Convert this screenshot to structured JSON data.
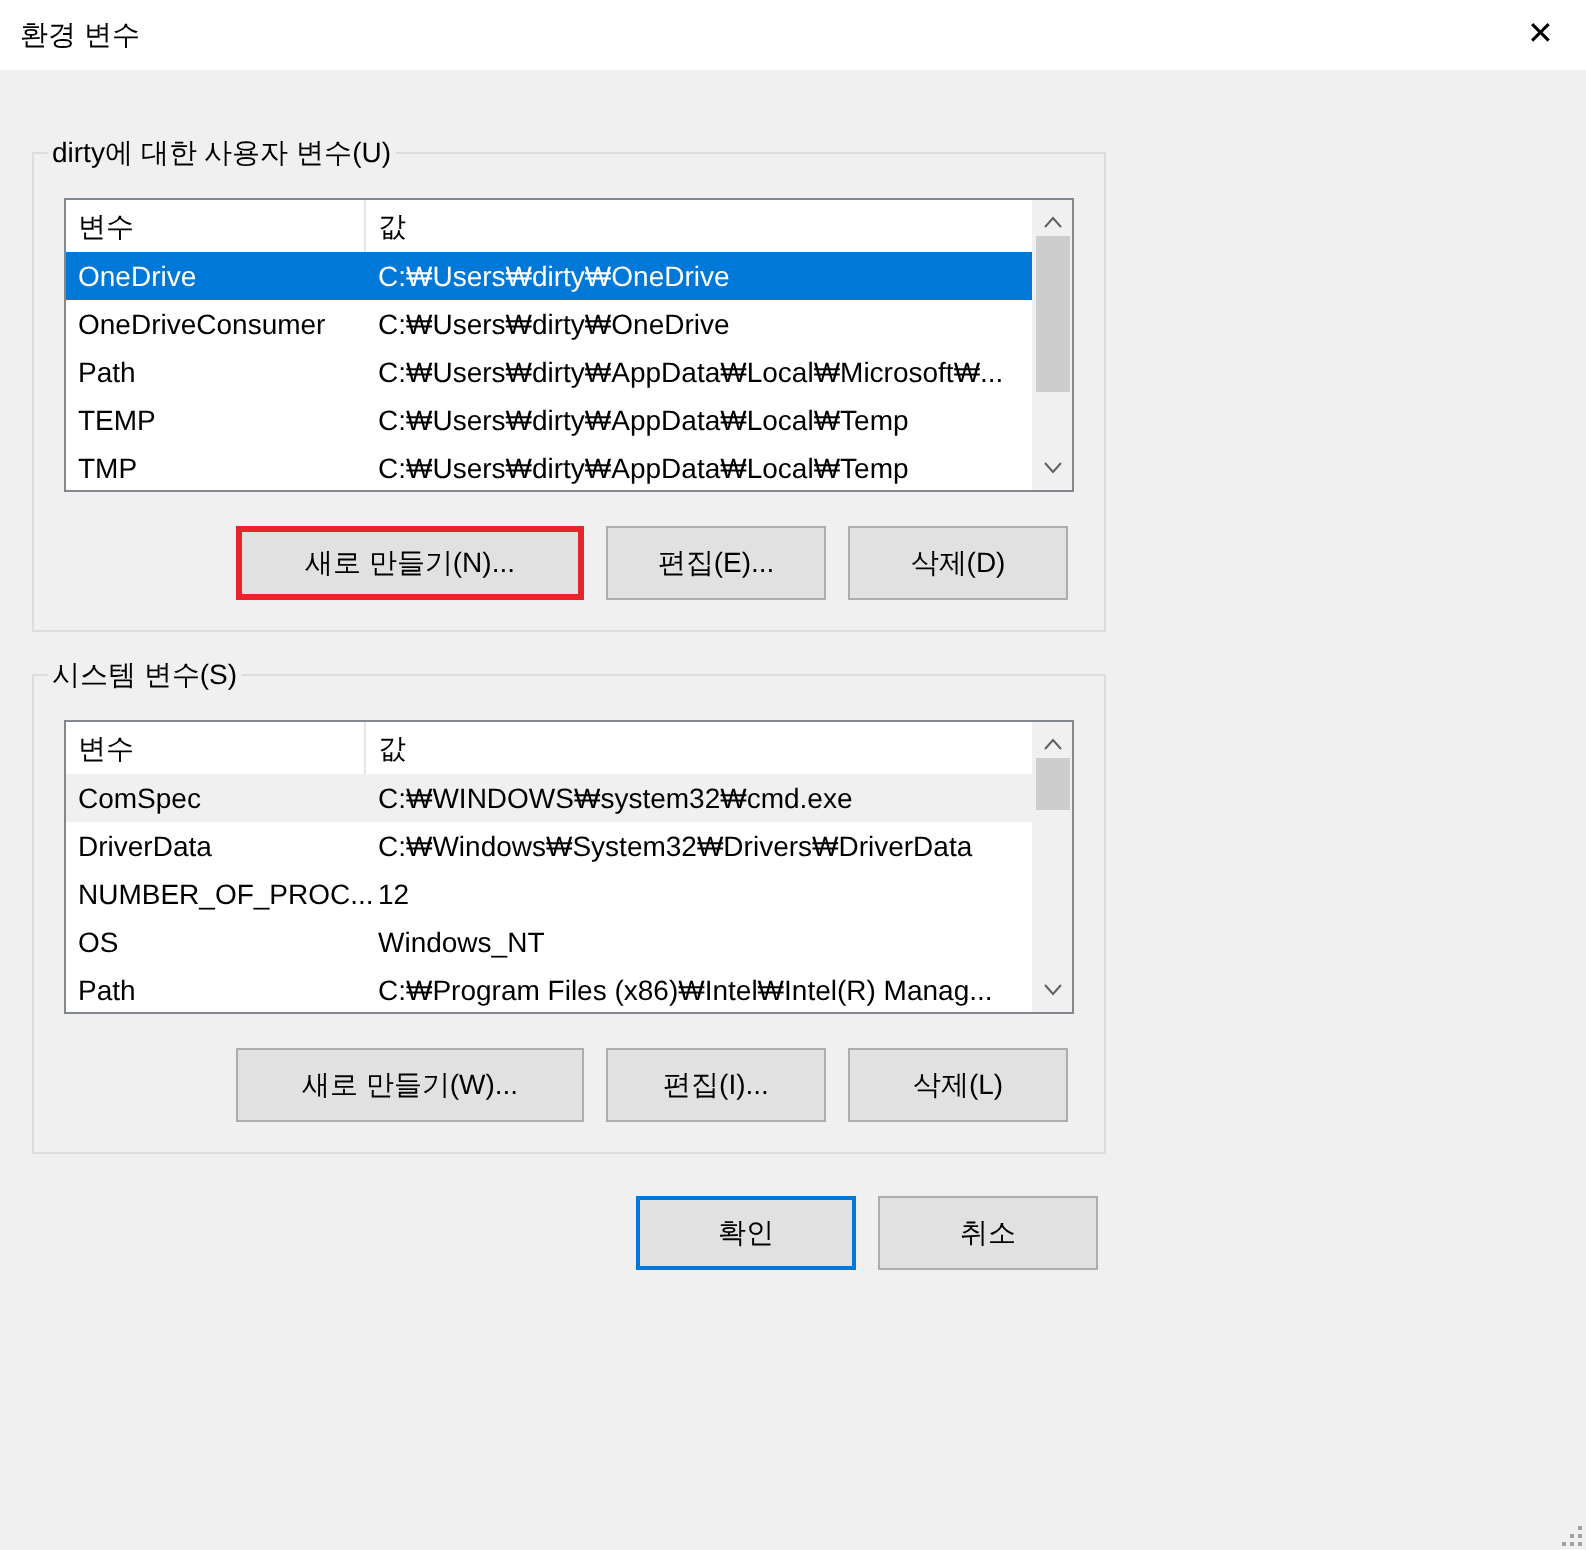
{
  "window": {
    "title": "환경 변수",
    "close": "✕"
  },
  "groups": [
    {
      "title": "dirty에 대한 사용자 변수(U)",
      "focused": true,
      "columns": [
        "변수",
        "값"
      ],
      "rows": [
        {
          "cells": [
            "OneDrive",
            "C:₩Users₩dirty₩OneDrive"
          ],
          "selected": true
        },
        {
          "cells": [
            "OneDriveConsumer",
            "C:₩Users₩dirty₩OneDrive"
          ],
          "selected": false
        },
        {
          "cells": [
            "Path",
            "C:₩Users₩dirty₩AppData₩Local₩Microsoft₩..."
          ],
          "selected": false
        },
        {
          "cells": [
            "TEMP",
            "C:₩Users₩dirty₩AppData₩Local₩Temp"
          ],
          "selected": false
        },
        {
          "cells": [
            "TMP",
            "C:₩Users₩dirty₩AppData₩Local₩Temp"
          ],
          "selected": false
        }
      ],
      "buttons": [
        {
          "label": "새로 만들기(N)...",
          "highlighted": true
        },
        {
          "label": "편집(E)...",
          "highlighted": false
        },
        {
          "label": "삭제(D)",
          "highlighted": false
        }
      ]
    },
    {
      "title": "시스템 변수(S)",
      "focused": false,
      "columns": [
        "변수",
        "값"
      ],
      "rows": [
        {
          "cells": [
            "ComSpec",
            "C:₩WINDOWS₩system32₩cmd.exe"
          ],
          "selected": true
        },
        {
          "cells": [
            "DriverData",
            "C:₩Windows₩System32₩Drivers₩DriverData"
          ],
          "selected": false
        },
        {
          "cells": [
            "NUMBER_OF_PROC...",
            "12"
          ],
          "selected": false
        },
        {
          "cells": [
            "OS",
            "Windows_NT"
          ],
          "selected": false
        },
        {
          "cells": [
            "Path",
            "C:₩Program Files (x86)₩Intel₩Intel(R) Manag..."
          ],
          "selected": false
        }
      ],
      "buttons": [
        {
          "label": "새로 만들기(W)...",
          "highlighted": false
        },
        {
          "label": "편집(I)...",
          "highlighted": false
        },
        {
          "label": "삭제(L)",
          "highlighted": false
        }
      ]
    }
  ],
  "footer_buttons": [
    {
      "label": "확인",
      "default": true
    },
    {
      "label": "취소",
      "default": false
    }
  ]
}
